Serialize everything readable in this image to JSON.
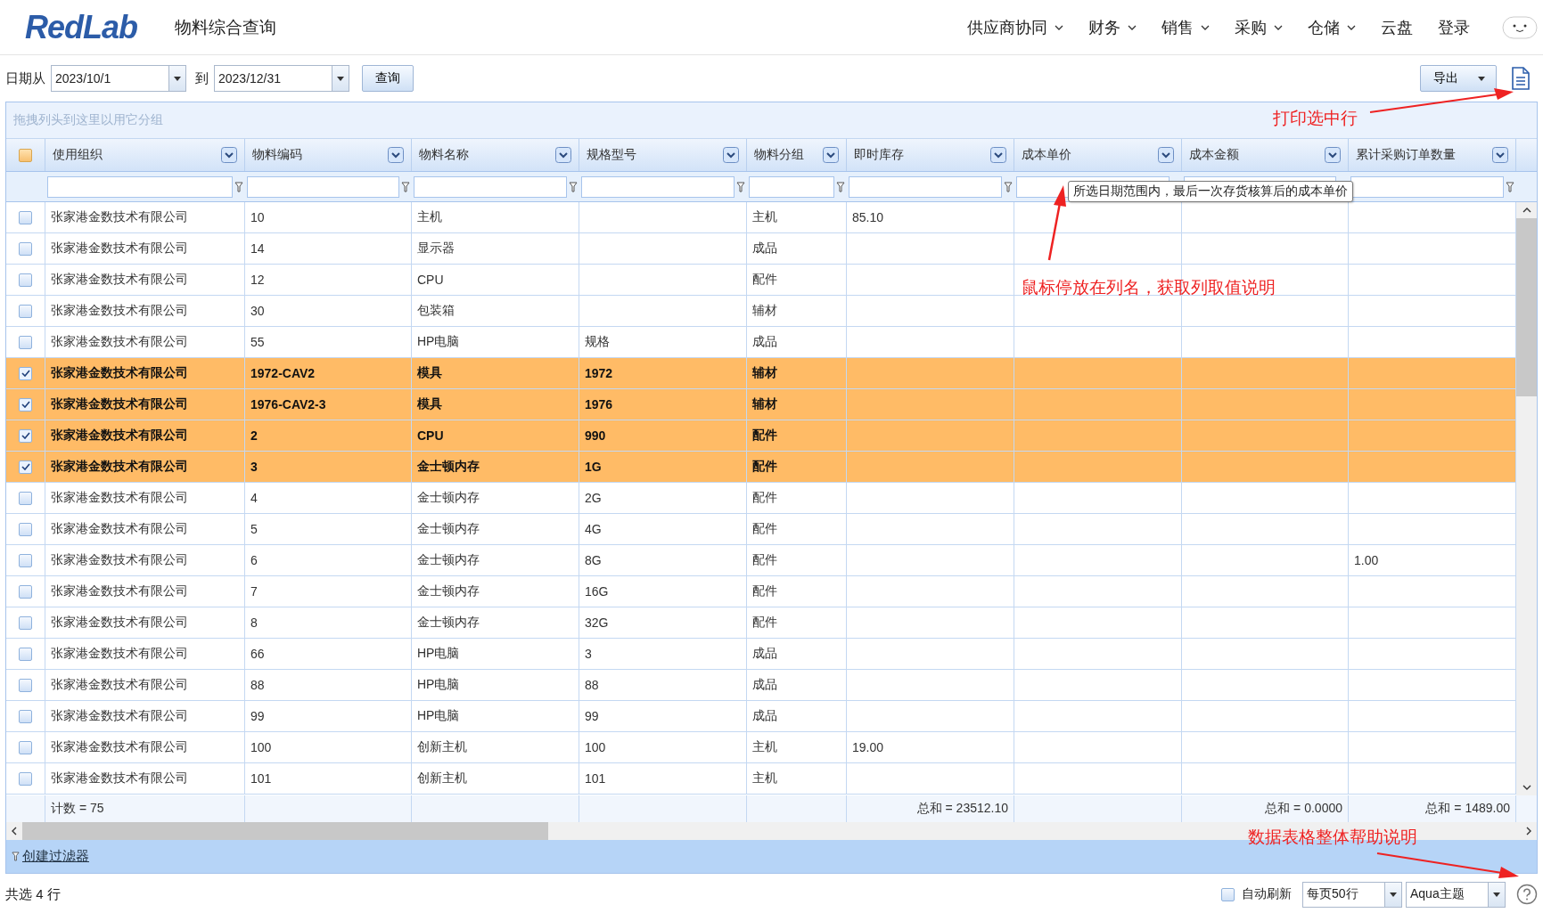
{
  "header": {
    "logo": "RedLab",
    "page_title": "物料综合查询",
    "nav": [
      {
        "label": "供应商协同",
        "dropdown": true
      },
      {
        "label": "财务",
        "dropdown": true
      },
      {
        "label": "销售",
        "dropdown": true
      },
      {
        "label": "采购",
        "dropdown": true
      },
      {
        "label": "仓储",
        "dropdown": true
      },
      {
        "label": "云盘",
        "dropdown": false
      },
      {
        "label": "登录",
        "dropdown": false
      }
    ]
  },
  "toolbar": {
    "from_label": "日期从",
    "from_value": "2023/10/1",
    "to_label": "到",
    "to_value": "2023/12/31",
    "query_button": "查询",
    "export_button": "导出"
  },
  "grid": {
    "group_hint": "拖拽列头到这里以用它分组",
    "select_all_partial": true,
    "columns": [
      {
        "label": "使用组织",
        "footer": "计数 = 75"
      },
      {
        "label": "物料编码"
      },
      {
        "label": "物料名称"
      },
      {
        "label": "规格型号"
      },
      {
        "label": "物料分组"
      },
      {
        "label": "即时库存",
        "footer": "总和 = 23512.10"
      },
      {
        "label": "成本单价"
      },
      {
        "label": "成本金额",
        "footer": "总和 = 0.0000"
      },
      {
        "label": "累计采购订单数量",
        "footer": "总和 = 1489.00"
      }
    ],
    "rows": [
      {
        "selected": false,
        "cells": [
          "张家港金数技术有限公司",
          "10",
          "主机",
          null,
          "主机",
          "85.10",
          null,
          null,
          null
        ]
      },
      {
        "selected": false,
        "cells": [
          "张家港金数技术有限公司",
          "14",
          "显示器",
          null,
          "成品",
          null,
          null,
          null,
          null
        ]
      },
      {
        "selected": false,
        "cells": [
          "张家港金数技术有限公司",
          "12",
          "CPU",
          null,
          "配件",
          null,
          null,
          null,
          null
        ]
      },
      {
        "selected": false,
        "cells": [
          "张家港金数技术有限公司",
          "30",
          "包装箱",
          null,
          "辅材",
          null,
          null,
          null,
          null
        ]
      },
      {
        "selected": false,
        "cells": [
          "张家港金数技术有限公司",
          "55",
          "HP电脑",
          "规格",
          "成品",
          null,
          null,
          null,
          null
        ]
      },
      {
        "selected": true,
        "cells": [
          "张家港金数技术有限公司",
          "1972-CAV2",
          "模具",
          "1972",
          "辅材",
          null,
          null,
          null,
          null
        ]
      },
      {
        "selected": true,
        "cells": [
          "张家港金数技术有限公司",
          "1976-CAV2-3",
          "模具",
          "1976",
          "辅材",
          null,
          null,
          null,
          null
        ]
      },
      {
        "selected": true,
        "cells": [
          "张家港金数技术有限公司",
          "2",
          "CPU",
          "990",
          "配件",
          null,
          null,
          null,
          null
        ]
      },
      {
        "selected": true,
        "cells": [
          "张家港金数技术有限公司",
          "3",
          "金士顿内存",
          "1G",
          "配件",
          null,
          null,
          null,
          null
        ]
      },
      {
        "selected": false,
        "cells": [
          "张家港金数技术有限公司",
          "4",
          "金士顿内存",
          "2G",
          "配件",
          null,
          null,
          null,
          null
        ]
      },
      {
        "selected": false,
        "cells": [
          "张家港金数技术有限公司",
          "5",
          "金士顿内存",
          "4G",
          "配件",
          null,
          null,
          null,
          null
        ]
      },
      {
        "selected": false,
        "cells": [
          "张家港金数技术有限公司",
          "6",
          "金士顿内存",
          "8G",
          "配件",
          null,
          null,
          null,
          "1.00"
        ]
      },
      {
        "selected": false,
        "cells": [
          "张家港金数技术有限公司",
          "7",
          "金士顿内存",
          "16G",
          "配件",
          null,
          null,
          null,
          null
        ]
      },
      {
        "selected": false,
        "cells": [
          "张家港金数技术有限公司",
          "8",
          "金士顿内存",
          "32G",
          "配件",
          null,
          null,
          null,
          null
        ]
      },
      {
        "selected": false,
        "cells": [
          "张家港金数技术有限公司",
          "66",
          "HP电脑",
          "3",
          "成品",
          null,
          null,
          null,
          null
        ]
      },
      {
        "selected": false,
        "cells": [
          "张家港金数技术有限公司",
          "88",
          "HP电脑",
          "88",
          "成品",
          null,
          null,
          null,
          null
        ]
      },
      {
        "selected": false,
        "cells": [
          "张家港金数技术有限公司",
          "99",
          "HP电脑",
          "99",
          "成品",
          null,
          null,
          null,
          null
        ]
      },
      {
        "selected": false,
        "cells": [
          "张家港金数技术有限公司",
          "100",
          "创新主机",
          "100",
          "主机",
          "19.00",
          null,
          null,
          null
        ]
      },
      {
        "selected": false,
        "cells": [
          "张家港金数技术有限公司",
          "101",
          "创新主机",
          "101",
          "主机",
          null,
          null,
          null,
          null
        ]
      }
    ],
    "tooltip": "所选日期范围内，最后一次存货核算后的成本单价",
    "create_filter": "创建过滤器"
  },
  "status_bar": {
    "selection_count": "共选 4 行",
    "auto_refresh": {
      "label": "自动刷新",
      "checked": false
    },
    "page_size": "每页50行",
    "theme": "Aqua主题"
  },
  "annotations": [
    {
      "kind": "print",
      "text": "打印选中行"
    },
    {
      "kind": "tooltip",
      "text": "鼠标停放在列名，获取列取值说明"
    },
    {
      "kind": "help",
      "text": "数据表格整体帮助说明"
    }
  ]
}
